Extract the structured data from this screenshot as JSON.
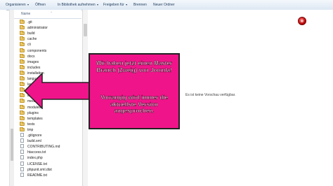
{
  "toolbar": {
    "organize": "Organisieren",
    "open": "Öffnen",
    "library": "In Bibliothek aufnehmen",
    "share": "Freigeben für",
    "burn": "Brennen",
    "new_folder": "Neuer Ordner",
    "dropdown_glyph": "▾"
  },
  "file_list": {
    "column_name": "Name",
    "sort_glyph": "^",
    "items": [
      {
        "name": ".git",
        "type": "folder"
      },
      {
        "name": "administrator",
        "type": "folder"
      },
      {
        "name": "build",
        "type": "folder"
      },
      {
        "name": "cache",
        "type": "folder"
      },
      {
        "name": "cli",
        "type": "folder"
      },
      {
        "name": "components",
        "type": "folder"
      },
      {
        "name": "docs",
        "type": "folder"
      },
      {
        "name": "images",
        "type": "folder"
      },
      {
        "name": "includes",
        "type": "folder"
      },
      {
        "name": "installation",
        "type": "folder"
      },
      {
        "name": "language",
        "type": "folder"
      },
      {
        "name": "layouts",
        "type": "folder"
      },
      {
        "name": "libraries",
        "type": "folder"
      },
      {
        "name": "logs",
        "type": "folder"
      },
      {
        "name": "media",
        "type": "folder"
      },
      {
        "name": "modules",
        "type": "folder"
      },
      {
        "name": "plugins",
        "type": "folder"
      },
      {
        "name": "templates",
        "type": "folder"
      },
      {
        "name": "tests",
        "type": "folder"
      },
      {
        "name": "tmp",
        "type": "folder"
      },
      {
        "name": ".gitignore",
        "type": "file"
      },
      {
        "name": "build.xml",
        "type": "file"
      },
      {
        "name": "CONTRIBUTING.md",
        "type": "file"
      },
      {
        "name": "htaccess.txt",
        "type": "file"
      },
      {
        "name": "index.php",
        "type": "file"
      },
      {
        "name": "LICENSE.txt",
        "type": "file"
      },
      {
        "name": "phpunit.xml.dist",
        "type": "file"
      },
      {
        "name": "README.txt",
        "type": "file"
      }
    ]
  },
  "preview": {
    "message": "Es ist keine Vorschau verfügbar."
  },
  "callout": {
    "line1": "Wir haben jetzt einen Master Branch (Zweig) von Joomla!",
    "line2": "Vorrangig wird immer die aktuellste Version angesprochen.",
    "fill_color": "#f0148a",
    "arrow_color": "#f0148a"
  }
}
